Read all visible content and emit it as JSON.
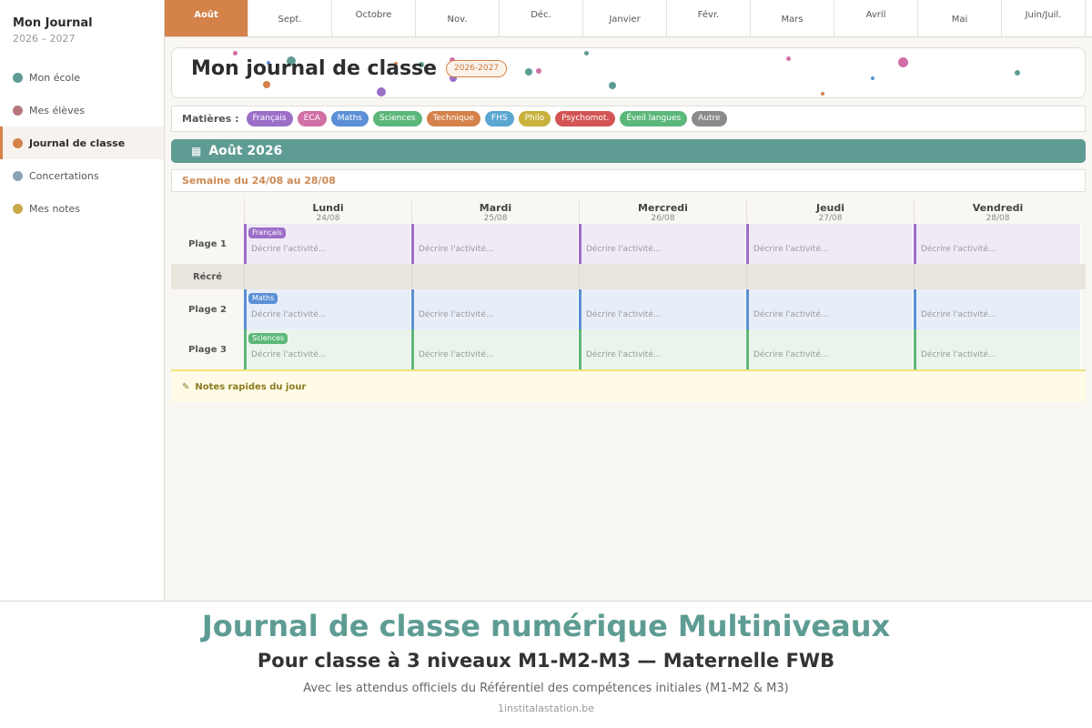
{
  "sidebar": {
    "title": "Mon Journal",
    "years": "2026 – 2027",
    "items": [
      {
        "label": "Mon école",
        "color": "#5e9c93",
        "name": "sidebar-item-mon-ecole"
      },
      {
        "label": "Mes élèves",
        "color": "#b5777c",
        "name": "sidebar-item-mes-eleves"
      },
      {
        "label": "Journal de classe",
        "color": "#d4824a",
        "name": "sidebar-item-journal",
        "active": true
      },
      {
        "label": "Concertations",
        "color": "#8aa3b5",
        "name": "sidebar-item-concertations"
      },
      {
        "label": "Mes notes",
        "color": "#c9a84a",
        "name": "sidebar-item-mes-notes"
      }
    ]
  },
  "tabs": [
    {
      "label": "Août",
      "active": true
    },
    {
      "label": "Sept."
    },
    {
      "label": "Octobre"
    },
    {
      "label": "Nov."
    },
    {
      "label": "Déc."
    },
    {
      "label": "Janvier"
    },
    {
      "label": "Févr."
    },
    {
      "label": "Mars"
    },
    {
      "label": "Avril"
    },
    {
      "label": "Mai"
    },
    {
      "label": "Juin/Juil."
    }
  ],
  "header": {
    "title": "Mon journal de classe",
    "badge": "2026-2027"
  },
  "subjects": {
    "label": "Matières :",
    "items": [
      {
        "label": "Français",
        "color": "#9b6ec8"
      },
      {
        "label": "ECA",
        "color": "#d16fa6"
      },
      {
        "label": "Maths",
        "color": "#5b8fd6"
      },
      {
        "label": "Sciences",
        "color": "#5cb87a"
      },
      {
        "label": "Technique",
        "color": "#d4824a"
      },
      {
        "label": "FHS",
        "color": "#5ba7d1"
      },
      {
        "label": "Philo",
        "color": "#c9b23c"
      },
      {
        "label": "Psychomot.",
        "color": "#d25454"
      },
      {
        "label": "Éveil langues",
        "color": "#5cb87a"
      },
      {
        "label": "Autre",
        "color": "#8a8a8a"
      }
    ]
  },
  "month": {
    "icon": "calendar-icon",
    "label": "Août 2026"
  },
  "week": {
    "label": "Semaine du 24/08 au 28/08"
  },
  "days": [
    {
      "name": "Lundi",
      "date": "24/08"
    },
    {
      "name": "Mardi",
      "date": "25/08"
    },
    {
      "name": "Mercredi",
      "date": "26/08"
    },
    {
      "name": "Jeudi",
      "date": "27/08"
    },
    {
      "name": "Vendredi",
      "date": "28/08"
    }
  ],
  "rows": [
    {
      "label": "Plage 1",
      "tag": "Français",
      "tag_color": "#9b6ec8",
      "bg": "#f0eaf6",
      "placeholder": "Décrire l'activité..."
    },
    {
      "label": "Récré",
      "recre": true
    },
    {
      "label": "Plage 2",
      "tag": "Maths",
      "tag_color": "#5b8fd6",
      "bg": "#e8eef8",
      "placeholder": "Décrire l'activité..."
    },
    {
      "label": "Plage 3",
      "tag": "Sciences",
      "tag_color": "#5cb87a",
      "bg": "#e9f4ec",
      "placeholder": "Décrire l'activité..."
    }
  ],
  "notes": {
    "icon": "note-icon",
    "label": "Notes rapides du jour"
  },
  "footer": {
    "title": "Journal de classe numérique Multiniveaux",
    "subtitle": "Pour classe à 3 niveaux M1-M2-M3 — Maternelle FWB",
    "description": "Avec les attendus officiels du Référentiel des compétences initiales (M1-M2 & M3)",
    "site": "1institalastation.be"
  }
}
